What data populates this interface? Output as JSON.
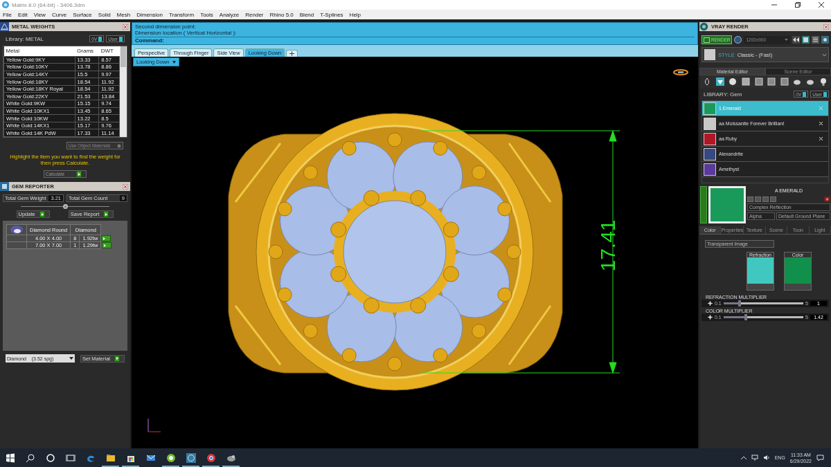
{
  "window": {
    "title": "Matrix 8.0 (64-bit) - 3406.3dm"
  },
  "menu": [
    "File",
    "Edit",
    "View",
    "Curve",
    "Surface",
    "Solid",
    "Mesh",
    "Dimension",
    "Transform",
    "Tools",
    "Analyze",
    "Render",
    "Rhino 5.0",
    "Blend",
    "T-Splines",
    "Help"
  ],
  "metal_weights": {
    "title": "METAL WEIGHTS",
    "library": "Library: METAL",
    "library_buttons": [
      "0V",
      "User"
    ],
    "columns": [
      "Metal",
      "Grams",
      "DWT"
    ],
    "rows": [
      [
        "Yellow Gold:9KY",
        "13.33",
        "8.57"
      ],
      [
        "Yellow Gold:10KY",
        "13.78",
        "8.86"
      ],
      [
        "Yellow Gold:14KY",
        "15.5",
        "9.97"
      ],
      [
        "Yellow Gold:18KY",
        "18.54",
        "11.92"
      ],
      [
        "Yellow Gold:18KY Royal",
        "18.54",
        "11.92"
      ],
      [
        "Yellow Gold:22KY",
        "21.53",
        "13.84"
      ],
      [
        "White Gold:9KW",
        "15.15",
        "9.74"
      ],
      [
        "White Gold:10KX1",
        "13.45",
        "8.65"
      ],
      [
        "White Gold:10KW",
        "13.22",
        "8.5"
      ],
      [
        "White Gold:14KX1",
        "15.17",
        "9.76"
      ],
      [
        "White Gold:14K PdW",
        "17.33",
        "11.14"
      ]
    ],
    "use_object_materials": "Use Object Materials",
    "hint": "Highlight the item you want to find the weight for then press Calculate.",
    "calculate": "Calculate"
  },
  "gem_reporter": {
    "title": "GEM REPORTER",
    "total_weight_label": "Total Gem Weight",
    "total_weight": "3.21",
    "total_count_label": "Total Gem Count",
    "total_count": "9",
    "update": "Update",
    "save_report": "Save Report",
    "table_header": [
      "Diamond Round",
      "Diamond"
    ],
    "rows": [
      {
        "size": "4.00 X 4.00",
        "count": "8",
        "weight": "1.92tw"
      },
      {
        "size": "7.00 X 7.00",
        "count": "1",
        "weight": "1.29tw"
      }
    ],
    "material": "Diamond    (3.52 spg)",
    "set_material": "Set Material"
  },
  "command": {
    "lines": [
      "Second dimension point:",
      "Dimension location ( Vertical  Horizontal ):"
    ],
    "prompt": "Command:"
  },
  "viewport_tabs": [
    {
      "label": "Perspective",
      "selected": false
    },
    {
      "label": "Through Finger",
      "selected": false
    },
    {
      "label": "Side View",
      "selected": false
    },
    {
      "label": "Looking Down",
      "selected": true
    }
  ],
  "viewport": {
    "label": "Looking Down",
    "dimension": "17.41"
  },
  "vray": {
    "title": "VRAY RENDER",
    "render": "RENDER",
    "resolution": "1200x900",
    "style_label": "STYLE",
    "style": "Classic - (Fast)",
    "tabs": [
      {
        "label": "Material Editor",
        "selected": true
      },
      {
        "label": "Scene Editor",
        "selected": false
      }
    ],
    "library": "LIBRARY: Gem",
    "library_buttons": [
      "0V",
      "User"
    ],
    "materials": [
      {
        "name": "1 Emerald",
        "selected": true,
        "removable": true,
        "color": "#1a9a5a"
      },
      {
        "name": "aa Moissanite Forever Brilliant",
        "selected": false,
        "removable": true,
        "color": "#c8c8c8"
      },
      {
        "name": "aa Ruby",
        "selected": false,
        "removable": true,
        "color": "#b01828"
      },
      {
        "name": "Alexandrite",
        "selected": false,
        "removable": false,
        "color": "#384880"
      },
      {
        "name": "Amethyst",
        "selected": false,
        "removable": false,
        "color": "#5a3a9a"
      }
    ],
    "material_title": "A EMERALD",
    "reflection": "Complex Reflection",
    "alpha": "Alpha",
    "ground": "Default Ground Plane",
    "editor_tabs": [
      {
        "label": "Color",
        "selected": true
      },
      {
        "label": "Properties",
        "selected": false
      },
      {
        "label": "Texture",
        "selected": false
      },
      {
        "label": "Scene",
        "selected": false
      },
      {
        "label": "Toon",
        "selected": false
      },
      {
        "label": "Light",
        "selected": false
      }
    ],
    "image_mode": "Transparent Image",
    "maps": [
      "Refraction",
      "Color"
    ],
    "sliders": [
      {
        "label": "REFRACTION MULTIPLIER",
        "min": "0.1",
        "max": "5",
        "value": "1",
        "level": 0.2
      },
      {
        "label": "COLOR MULTIPLIER",
        "min": "0.1",
        "max": "5",
        "value": "1.42",
        "level": 0.28
      }
    ]
  },
  "taskbar": {
    "apps": [
      {
        "kind": "edge",
        "running": false
      },
      {
        "kind": "folder",
        "running": true
      },
      {
        "kind": "store",
        "running": true
      },
      {
        "kind": "mail",
        "running": false
      },
      {
        "kind": "green",
        "running": true
      },
      {
        "kind": "matrix",
        "running": true
      },
      {
        "kind": "chrome",
        "running": true
      },
      {
        "kind": "rhino",
        "running": true
      }
    ],
    "language": "ENG",
    "time": "11:33 AM",
    "date": "6/29/2022"
  }
}
